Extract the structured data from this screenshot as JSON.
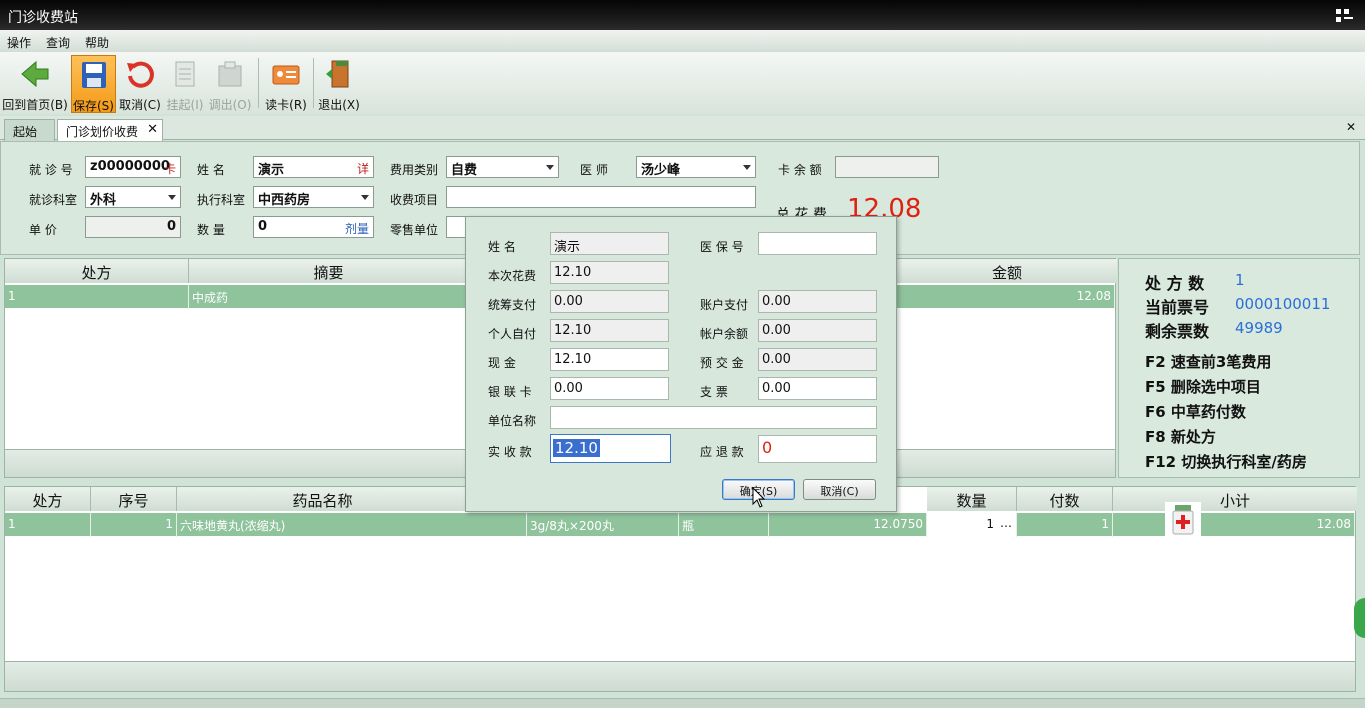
{
  "window": {
    "title": "门诊收费站"
  },
  "menu": [
    "操作",
    "查询",
    "帮助"
  ],
  "toolbar": [
    {
      "label": "回到首页(B)",
      "icon": "back-arrow-icon",
      "state": "normal"
    },
    {
      "label": "保存(S)",
      "icon": "save-icon",
      "state": "selected"
    },
    {
      "label": "取消(C)",
      "icon": "undo-icon",
      "state": "normal"
    },
    {
      "label": "挂起(I)",
      "icon": "suspend-icon",
      "state": "disabled"
    },
    {
      "label": "调出(O)",
      "icon": "recall-icon",
      "state": "disabled"
    },
    {
      "label": "读卡(R)",
      "icon": "id-card-icon",
      "state": "normal"
    },
    {
      "label": "退出(X)",
      "icon": "exit-door-icon",
      "state": "normal"
    }
  ],
  "tabs": [
    {
      "label": "起始页",
      "active": false
    },
    {
      "label": "门诊划价收费",
      "active": true,
      "close": "✕"
    }
  ],
  "tabbar_close": "✕",
  "form": {
    "visit_no": {
      "label": "就 诊 号",
      "value": "z00000000",
      "suffix": "卡"
    },
    "name": {
      "label": "姓   名",
      "value": "演示",
      "suffix": "详"
    },
    "fee_type": {
      "label": "费用类别",
      "value": "自费"
    },
    "doctor": {
      "label": "医   师",
      "value": "汤少峰"
    },
    "card_balance": {
      "label": "卡 余 额",
      "value": ""
    },
    "dept": {
      "label": "就诊科室",
      "value": "外科"
    },
    "exec_dept": {
      "label": "执行科室",
      "value": "中西药房"
    },
    "charge_item": {
      "label": "收费项目",
      "value": ""
    },
    "total_label": "总 花 费",
    "total_value": "12.08",
    "unit_price": {
      "label": "单   价",
      "value": "0"
    },
    "quantity": {
      "label": "数   量",
      "value": "0",
      "suffix": "剂量"
    },
    "retail_unit": {
      "label": "零售单位",
      "value": ""
    }
  },
  "prescription_grid": {
    "headers": [
      "处方",
      "摘要",
      "金额"
    ],
    "rows": [
      [
        "1",
        "中成药",
        "12.08"
      ]
    ]
  },
  "info_panel": {
    "rx_count_label": "处 方 数",
    "rx_count": "1",
    "ticket_no_label": "当前票号",
    "ticket_no": "0000100011",
    "tickets_left_label": "剩余票数",
    "tickets_left": "49989",
    "shortcuts": [
      "F2  速查前3笔费用",
      "F5  删除选中项目",
      "F6  中草药付数",
      "F8  新处方",
      "F12  切换执行科室/药房"
    ]
  },
  "drug_grid": {
    "headers": [
      "处方",
      "序号",
      "药品名称",
      "数量",
      "付数",
      "小计"
    ],
    "rows": [
      {
        "rx": "1",
        "seq": "1",
        "name": "六味地黄丸(浓缩丸)",
        "spec": "3g/8丸×200丸",
        "unit": "瓶",
        "price": "12.0750",
        "qty": "1",
        "more": "…",
        "doses": "1",
        "subtotal": "12.08"
      }
    ]
  },
  "dialog": {
    "name_label": "姓   名",
    "name": "演示",
    "ins_no_label": "医 保 号",
    "ins_no": "",
    "cost_label": "本次花费",
    "cost": "12.10",
    "pool_label": "统筹支付",
    "pool": "0.00",
    "acct_pay_label": "账户支付",
    "acct_pay": "0.00",
    "self_label": "个人自付",
    "self_pay": "12.10",
    "acct_bal_label": "帐户余额",
    "acct_bal": "0.00",
    "cash_label": "现    金",
    "cash": "12.10",
    "deposit_label": "预 交 金",
    "deposit": "0.00",
    "unionpay_label": "银 联 卡",
    "unionpay": "0.00",
    "cheque_label": "支    票",
    "cheque": "0.00",
    "unit_name_label": "单位名称",
    "unit_name": "",
    "received_label": "实 收 款",
    "received": "12.10",
    "change_label": "应 退 款",
    "change": "0",
    "ok_label": "确定(S)",
    "cancel_label": "取消(C)"
  }
}
